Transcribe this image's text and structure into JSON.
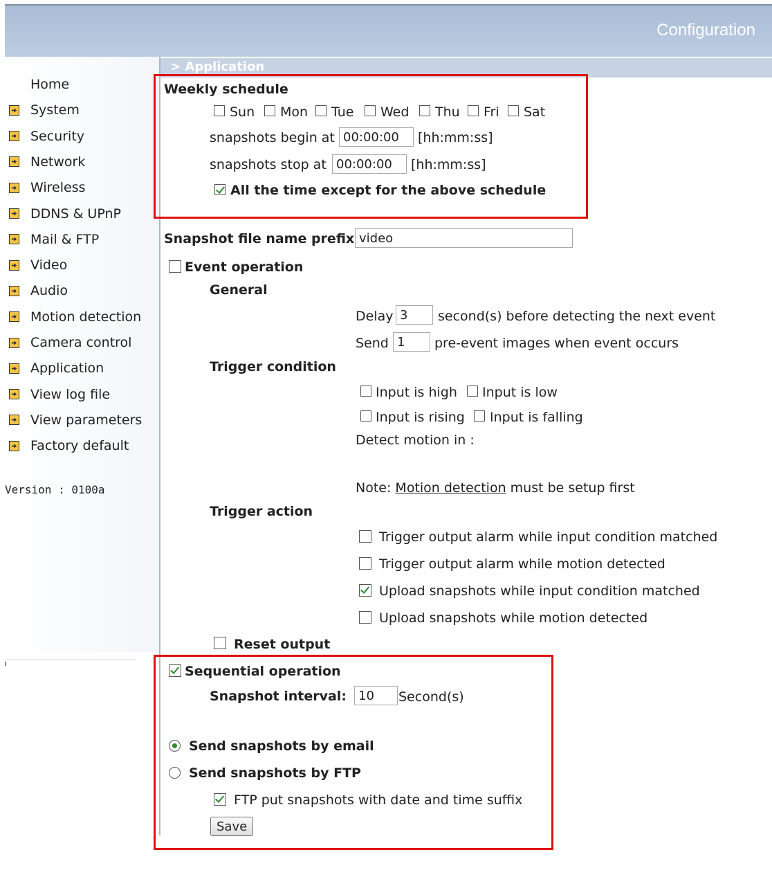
{
  "header": {
    "title": "Configuration"
  },
  "breadcrumb": "> Application",
  "sidebar": {
    "items": [
      {
        "label": "Home",
        "icon": ""
      },
      {
        "label": "System",
        "icon": "arrow-icon"
      },
      {
        "label": "Security",
        "icon": "arrow-icon"
      },
      {
        "label": "Network",
        "icon": "arrow-icon"
      },
      {
        "label": "Wireless",
        "icon": "arrow-icon"
      },
      {
        "label": "DDNS & UPnP",
        "icon": "arrow-icon"
      },
      {
        "label": "Mail & FTP",
        "icon": "arrow-icon"
      },
      {
        "label": "Video",
        "icon": "arrow-icon"
      },
      {
        "label": "Audio",
        "icon": "arrow-icon"
      },
      {
        "label": "Motion detection",
        "icon": "arrow-icon"
      },
      {
        "label": "Camera control",
        "icon": "arrow-icon"
      },
      {
        "label": "Application",
        "icon": "arrow-icon"
      },
      {
        "label": "View log file",
        "icon": "arrow-icon"
      },
      {
        "label": "View parameters",
        "icon": "arrow-icon"
      },
      {
        "label": "Factory default",
        "icon": "arrow-icon"
      }
    ],
    "version": "Version : 0100a"
  },
  "weekly": {
    "title": "Weekly schedule",
    "days": [
      {
        "label": "Sun",
        "checked": false
      },
      {
        "label": "Mon",
        "checked": false
      },
      {
        "label": "Tue",
        "checked": false
      },
      {
        "label": "Wed",
        "checked": false
      },
      {
        "label": "Thu",
        "checked": false
      },
      {
        "label": "Fri",
        "checked": false
      },
      {
        "label": "Sat",
        "checked": false
      }
    ],
    "begin_label": "snapshots begin at",
    "begin_value": "00:00:00",
    "stop_label": "snapshots stop at",
    "stop_value": "00:00:00",
    "time_format": "[hh:mm:ss]",
    "except_label": "All the time except for the above schedule",
    "except_checked": true
  },
  "prefix": {
    "label": "Snapshot file name prefix",
    "value": "video"
  },
  "event": {
    "label": "Event operation",
    "checked": false,
    "general": "General",
    "delay_label": "Delay",
    "delay_value": "3",
    "delay_suffix": "second(s) before detecting the next event",
    "send_label": "Send",
    "send_value": "1",
    "send_suffix": "pre-event images when event occurs",
    "trigger_condition": "Trigger condition",
    "input_high": "Input is high",
    "input_low": "Input is low",
    "input_rising": "Input is rising",
    "input_falling": "Input is falling",
    "detect_motion": "Detect motion in :",
    "note_prefix": "Note: ",
    "note_link": "Motion detection",
    "note_suffix": " must be setup first",
    "trigger_action": "Trigger action",
    "actions": [
      {
        "label": "Trigger output alarm while input condition matched",
        "checked": false
      },
      {
        "label": "Trigger output alarm while motion detected",
        "checked": false
      },
      {
        "label": "Upload snapshots while input condition matched",
        "checked": true
      },
      {
        "label": "Upload snapshots while motion detected",
        "checked": false
      }
    ],
    "reset_output": "Reset output"
  },
  "sequential": {
    "label": "Sequential operation",
    "checked": true,
    "interval_label": "Snapshot interval:",
    "interval_value": "10",
    "interval_unit": "Second(s)"
  },
  "send": {
    "email_label": "Send snapshots by email",
    "email_selected": true,
    "ftp_label": "Send snapshots by FTP",
    "ftp_selected": false,
    "ftp_suffix_label": "FTP put snapshots with date and time suffix",
    "ftp_suffix_checked": true
  },
  "save_label": "Save",
  "colors": {
    "highlight": "#e01010",
    "header": "#b3c4db",
    "check": "#2e8b2e"
  }
}
